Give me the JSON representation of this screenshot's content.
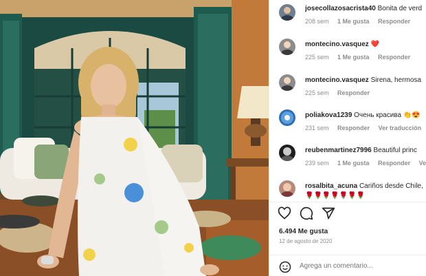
{
  "comments": [
    {
      "user": "josecollazosacrista40",
      "text": "Bonita de verd",
      "time": "208 sem",
      "likes": "1 Me gusta",
      "reply": "Responder",
      "extra": ""
    },
    {
      "user": "montecino.vasquez",
      "text": "❤️",
      "time": "225 sem",
      "likes": "1 Me gusta",
      "reply": "Responder",
      "extra": ""
    },
    {
      "user": "montecino.vasquez",
      "text": "Sirena, hermosa",
      "time": "225 sem",
      "likes": "",
      "reply": "Responder",
      "extra": ""
    },
    {
      "user": "poliakova1239",
      "text": "Очень красива 👏😍",
      "time": "231 sem",
      "likes": "",
      "reply": "Responder",
      "extra": "Ver traducción"
    },
    {
      "user": "reubenmartinez7996",
      "text": "Beautiful princ",
      "time": "239 sem",
      "likes": "1 Me gusta",
      "reply": "Responder",
      "extra": "Ver tr"
    },
    {
      "user": "rosalbita_acuna",
      "text": "Cariños desde Chile,",
      "time": "",
      "likes": "",
      "reply": "",
      "extra": "",
      "emoji_row": "🌹🌹🌹🌹🌹🌹🌹"
    }
  ],
  "post": {
    "likes": "6.494 Me gusta",
    "date": "12 de agosto de 2020",
    "add_comment_placeholder": "Agrega un comentario..."
  },
  "icons": {
    "like": "heart-icon",
    "comment": "comment-icon",
    "share": "share-icon",
    "emoji": "emoji-icon"
  },
  "colors": {
    "text": "#262626",
    "secondary": "#8e8e8e",
    "heart": "#ed4956"
  }
}
